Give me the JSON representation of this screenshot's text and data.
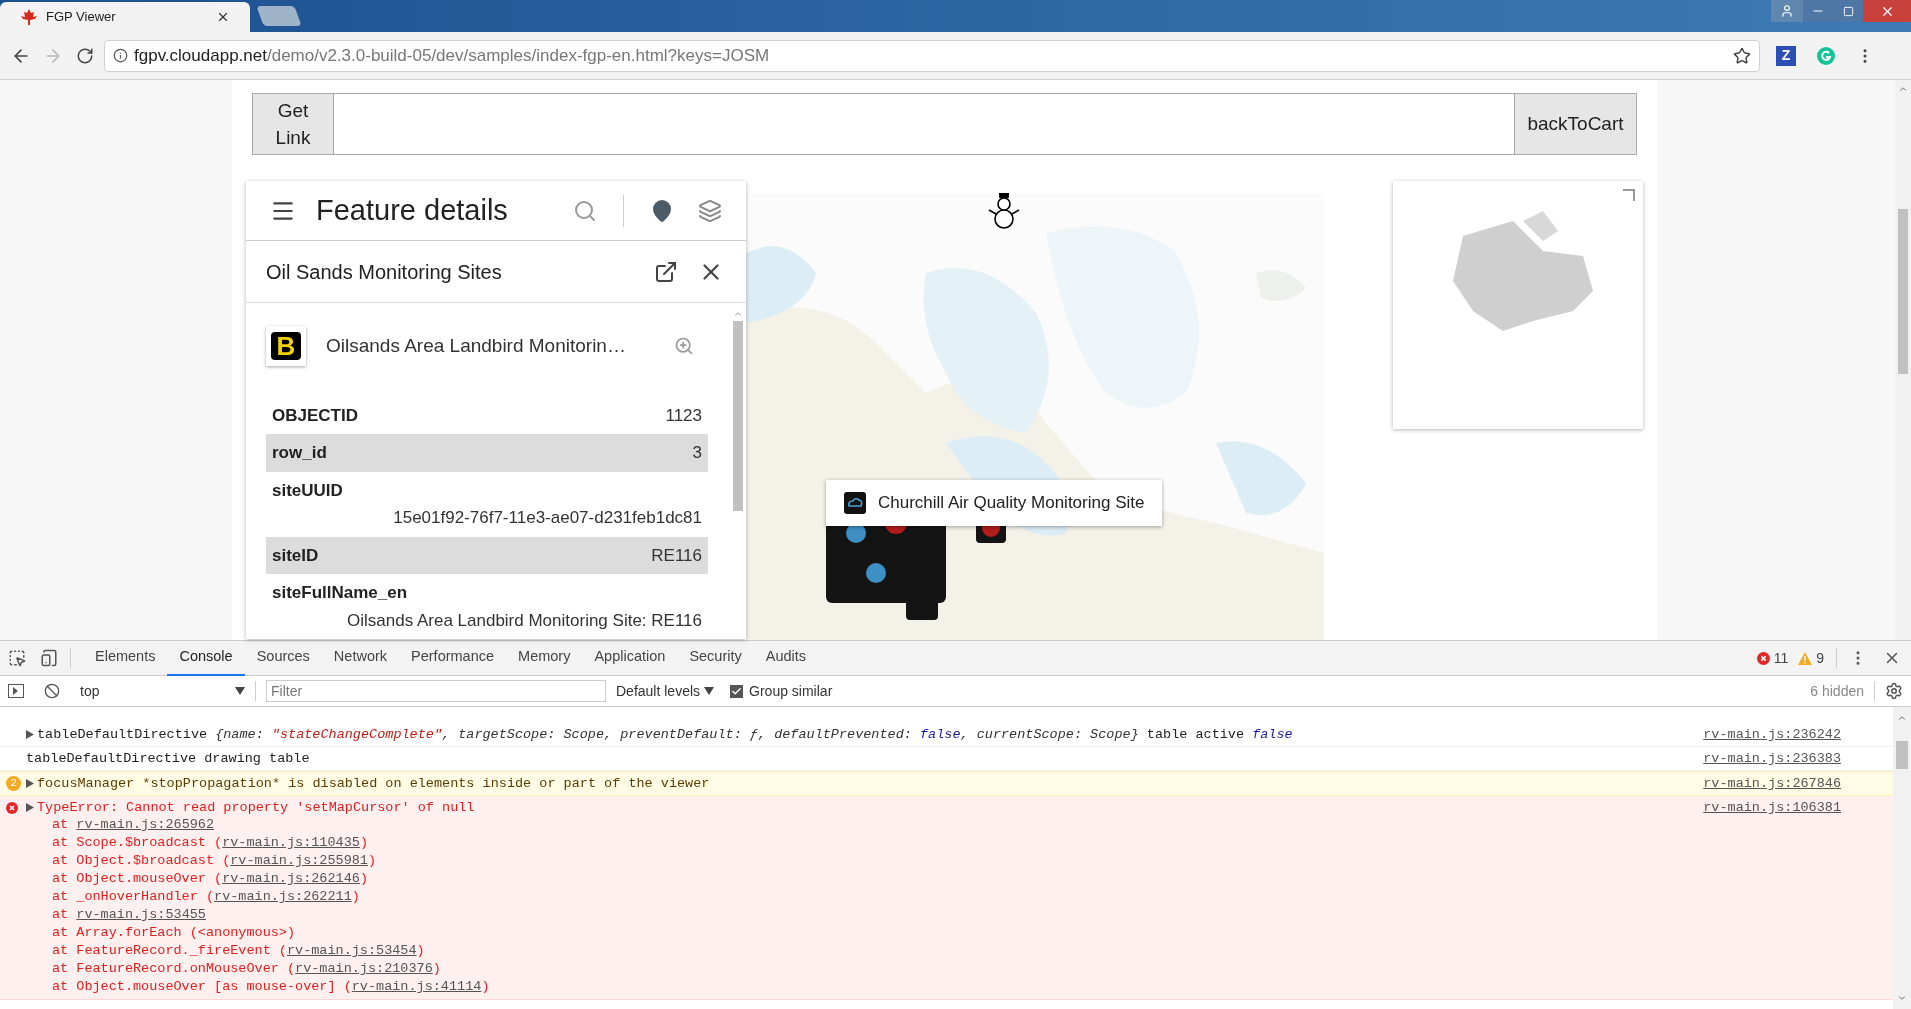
{
  "browser": {
    "tab_title": "FGP Viewer",
    "url_host": "fgpv.cloudapp.net",
    "url_path": "/demo/v2.3.0-build-05/dev/samples/index-fgp-en.html?keys=JOSM",
    "extension_label": "Z"
  },
  "page": {
    "get_link": "Get Link",
    "back_to_cart": "backToCart"
  },
  "panel": {
    "title": "Feature details",
    "layer": "Oil Sands Monitoring Sites",
    "symbol": "B",
    "feature_name": "Oilsands Area Landbird Monitorin…",
    "fields": [
      {
        "name": "OBJECTID",
        "value": "1123",
        "kind": "inline"
      },
      {
        "name": "row_id",
        "value": "3",
        "kind": "inline"
      },
      {
        "name": "siteUUID",
        "value": "15e01f92-76f7-11e3-ae07-d231feb1dc81",
        "kind": "stacked"
      },
      {
        "name": "siteID",
        "value": "RE116",
        "kind": "inline"
      },
      {
        "name": "siteFullName_en",
        "value": "Oilsands Area Landbird Monitoring Site: RE116",
        "kind": "stacked"
      }
    ]
  },
  "map": {
    "tooltip": "Churchill Air Quality Monitoring Site"
  },
  "devtools": {
    "tabs": [
      {
        "label": "Elements",
        "selected": false
      },
      {
        "label": "Console",
        "selected": true
      },
      {
        "label": "Sources",
        "selected": false
      },
      {
        "label": "Network",
        "selected": false
      },
      {
        "label": "Performance",
        "selected": false
      },
      {
        "label": "Memory",
        "selected": false
      },
      {
        "label": "Application",
        "selected": false
      },
      {
        "label": "Security",
        "selected": false
      },
      {
        "label": "Audits",
        "selected": false
      }
    ],
    "error_count": "11",
    "warning_count": "9",
    "context": "top",
    "filter_placeholder": "Filter",
    "levels": "Default levels",
    "group_similar": {
      "label": "Group similar",
      "checked": true
    },
    "hidden": "6 hidden",
    "messages": [
      {
        "kind": "log",
        "label": "tableDefaultDirective",
        "expandable": true,
        "parts": [
          {
            "kind": "italic",
            "text": "{name: "
          },
          {
            "kind": "string",
            "text": "\"stateChangeComplete\""
          },
          {
            "kind": "italic",
            "text": ", targetScope: Scope, preventDefault: ƒ, defaultPrevented: "
          },
          {
            "kind": "keyword",
            "text": "false"
          },
          {
            "kind": "italic",
            "text": ", currentScope: Scope}"
          },
          {
            "kind": "plain",
            "text": " table active "
          },
          {
            "kind": "keyword",
            "text": "false"
          }
        ],
        "source": "rv-main.js:236242"
      },
      {
        "kind": "log",
        "label": "tableDefaultDirective drawing table",
        "expandable": false,
        "source": "rv-main.js:236383"
      },
      {
        "kind": "warning",
        "count": "2",
        "label": "focusManager *stopPropagation* is disabled on elements inside or part of the viewer",
        "expandable": true,
        "source": "rv-main.js:267846"
      },
      {
        "kind": "error",
        "label": "TypeError: Cannot read property 'setMapCursor' of null",
        "expandable": true,
        "source": "rv-main.js:106381",
        "stack": [
          {
            "before": "at ",
            "link": "rv-main.js:265962"
          },
          {
            "before": "at Scope.$broadcast (",
            "link": "rv-main.js:110435",
            "after": ")"
          },
          {
            "before": "at Object.$broadcast (",
            "link": "rv-main.js:255981",
            "after": ")"
          },
          {
            "before": "at Object.mouseOver (",
            "link": "rv-main.js:262146",
            "after": ")"
          },
          {
            "before": "at _onHoverHandler (",
            "link": "rv-main.js:262211",
            "after": ")"
          },
          {
            "before": "at ",
            "link": "rv-main.js:53455"
          },
          {
            "before": "at Array.forEach (<anonymous>)"
          },
          {
            "before": "at FeatureRecord._fireEvent (",
            "link": "rv-main.js:53454",
            "after": ")"
          },
          {
            "before": "at FeatureRecord.onMouseOver (",
            "link": "rv-main.js:210376",
            "after": ")"
          },
          {
            "before": "at Object.mouseOver [as mouse-over] (",
            "link": "rv-main.js:41114",
            "after": ")"
          }
        ]
      }
    ]
  }
}
